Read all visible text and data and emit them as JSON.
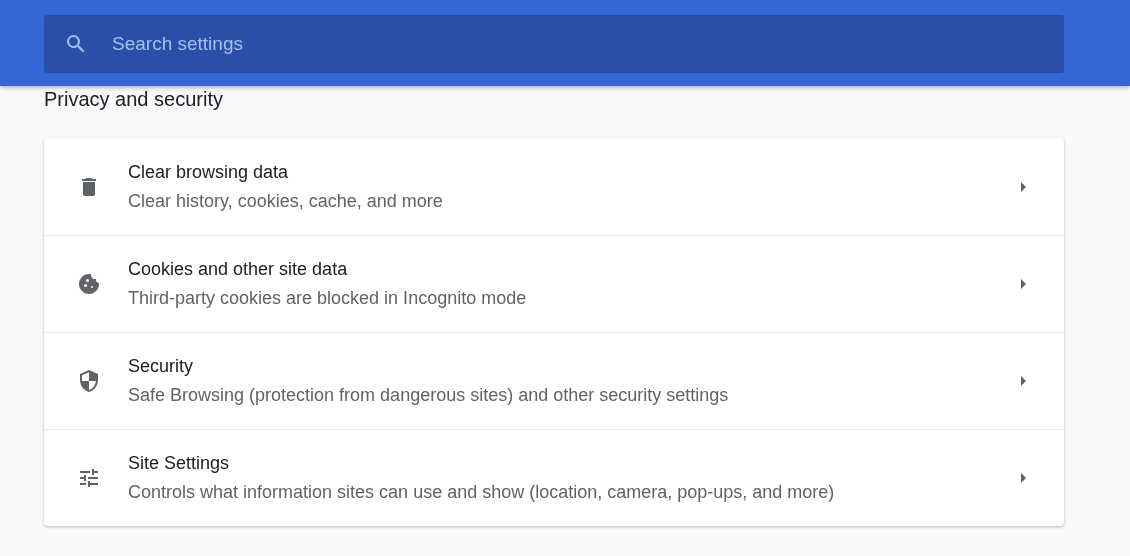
{
  "search": {
    "placeholder": "Search settings"
  },
  "section_title": "Privacy and security",
  "rows": [
    {
      "kind": "trash",
      "title": "Clear browsing data",
      "subtitle": "Clear history, cookies, cache, and more"
    },
    {
      "kind": "cookie",
      "title": "Cookies and other site data",
      "subtitle": "Third-party cookies are blocked in Incognito mode"
    },
    {
      "kind": "shield",
      "title": "Security",
      "subtitle": "Safe Browsing (protection from dangerous sites) and other security settings"
    },
    {
      "kind": "sliders",
      "title": "Site Settings",
      "subtitle": "Controls what information sites can use and show (location, camera, pop-ups, and more)"
    }
  ]
}
